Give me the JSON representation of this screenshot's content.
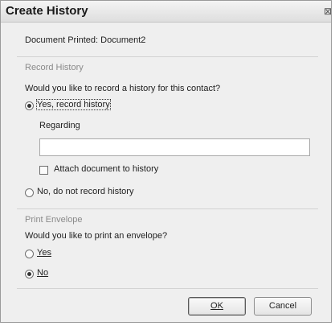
{
  "window": {
    "title": "Create History",
    "close_glyph": "⊠"
  },
  "document_printed": "Document Printed: Document2",
  "record_history": {
    "group_label": "Record History",
    "question": "Would you like to record a history for this contact?",
    "yes_label": "Yes, record history",
    "yes_checked": true,
    "regarding_label": "Regarding",
    "regarding_value": "",
    "attach_label": "Attach document to history",
    "attach_checked": false,
    "no_label": "No, do not record history",
    "no_checked": false
  },
  "print_envelope": {
    "group_label": "Print Envelope",
    "question": "Would you like to print an envelope?",
    "yes_label": "Yes",
    "yes_checked": false,
    "no_label": "No",
    "no_checked": true
  },
  "buttons": {
    "ok_label": "OK",
    "cancel_label": "Cancel"
  }
}
